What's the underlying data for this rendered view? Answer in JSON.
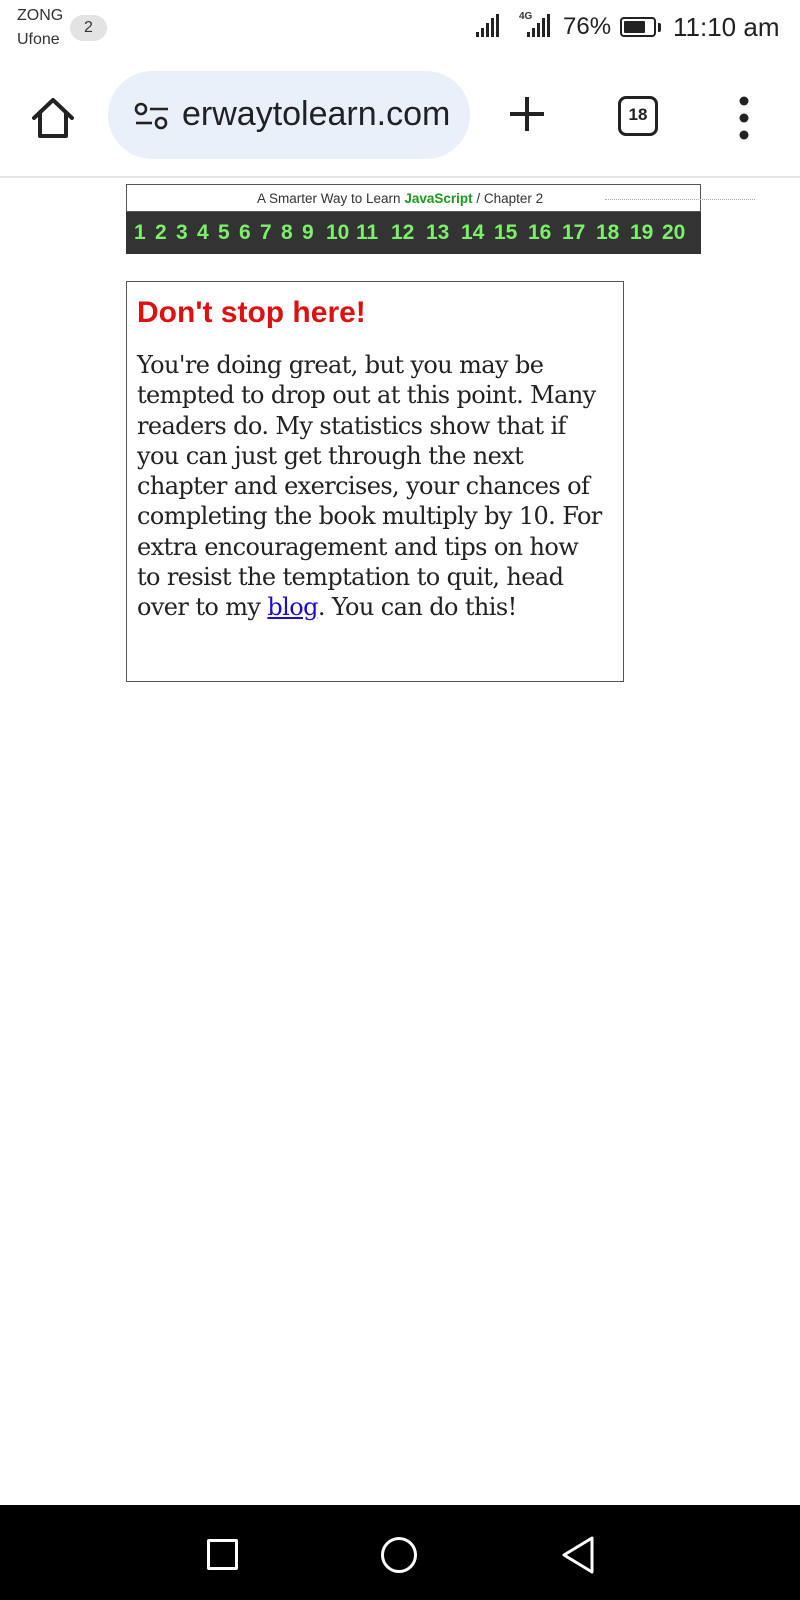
{
  "status_bar": {
    "carrier_1": "ZONG",
    "carrier_2": "Ufone",
    "notification_count": "2",
    "network_type": "4G",
    "battery_percent": "76%",
    "battery_level": 0.76,
    "time": "11:10 am"
  },
  "browser": {
    "url": "erwaytolearn.com",
    "tab_count": "18",
    "icons": {
      "home": "home-icon",
      "site_settings": "tune-icon",
      "new_tab": "plus-icon",
      "menu": "more-vert-icon"
    }
  },
  "chapter_nav": {
    "title_prefix": "A Smarter Way to Learn ",
    "title_highlight": "JavaScript",
    "title_suffix": " / Chapter 2",
    "chapters": [
      "1",
      "2",
      "3",
      "4",
      "5",
      "6",
      "7",
      "8",
      "9",
      "10",
      "11",
      "12",
      "13",
      "14",
      "15",
      "16",
      "17",
      "18",
      "19",
      "20"
    ]
  },
  "callout": {
    "heading": "Don't stop here!",
    "body_before_link": "You're doing great, but you may be tempted to drop out at this point. Many readers do. My statistics show that if you can just get through the next chapter and exercises, your chances of completing the book multiply by 10. For extra encouragement and tips on how to resist the temptation to quit, head over to my ",
    "link_text": "blog",
    "body_after_link": ". You can do this!"
  },
  "colors": {
    "heading_red": "#dd1111",
    "chapter_green": "#7cf06a",
    "chapter_bar_bg": "#333333",
    "link_blue": "#1a0dcc",
    "url_pill_bg": "#eaf0fa"
  },
  "nav_bar": {
    "icons": [
      "recent-apps-icon",
      "home-circle-icon",
      "back-icon"
    ]
  }
}
